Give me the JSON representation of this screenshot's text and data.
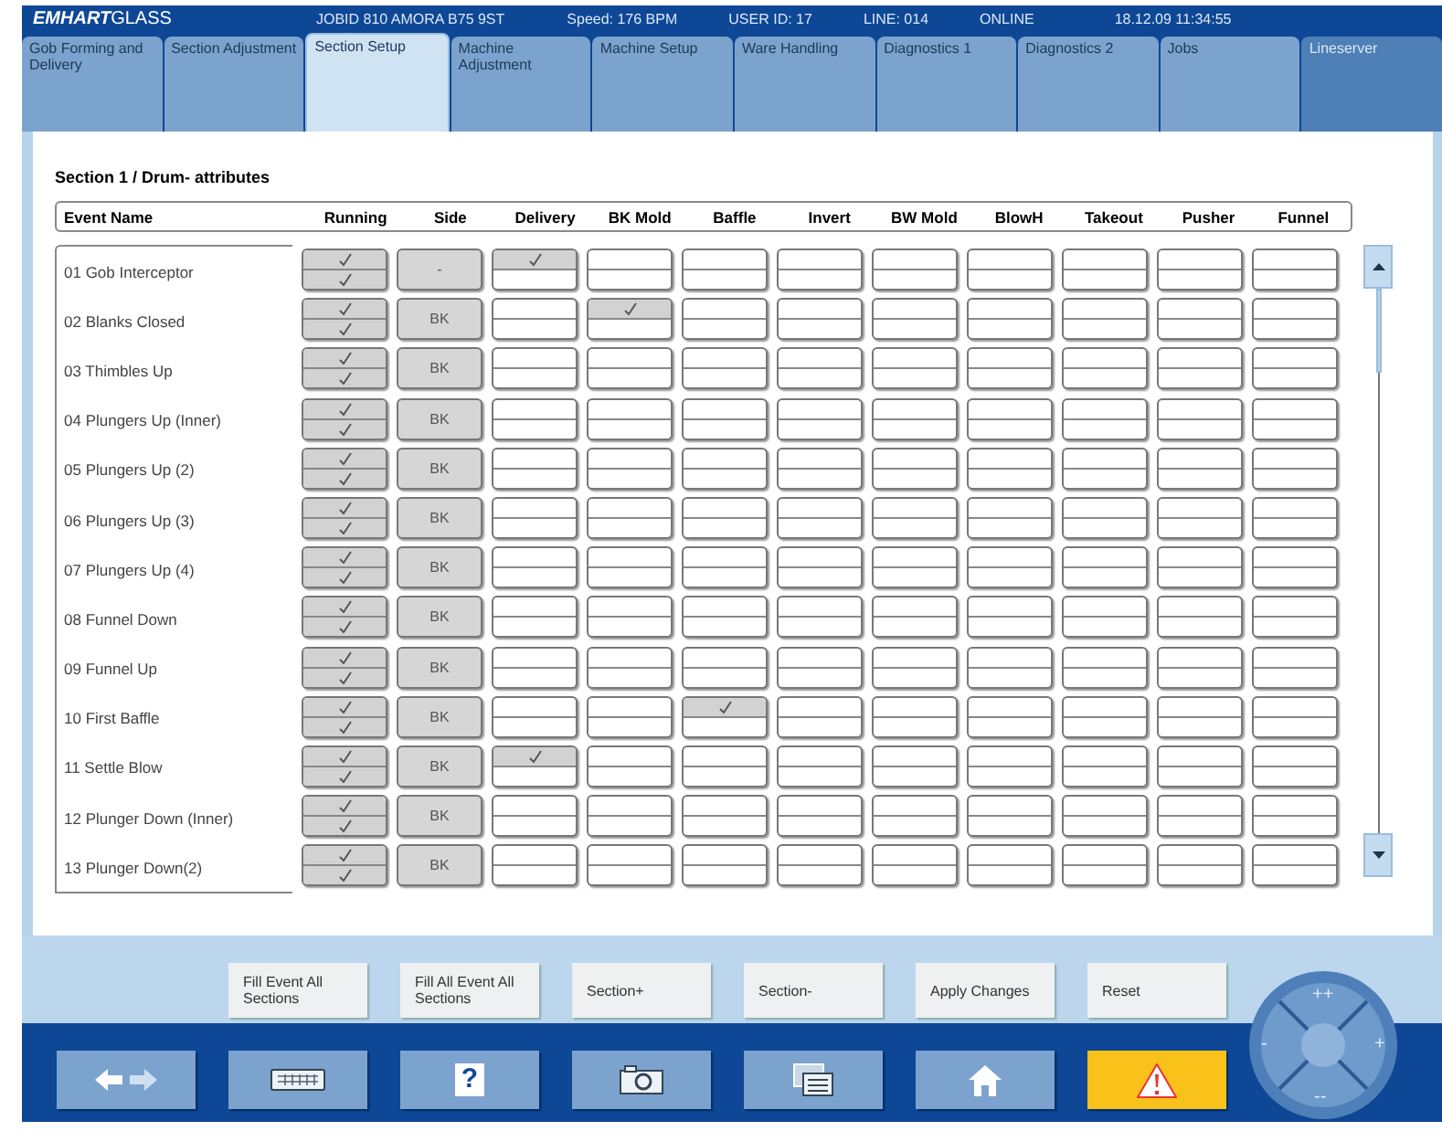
{
  "header": {
    "logo_bold": "EMHART",
    "logo_light": "GLASS",
    "info": [
      "JOBID 810 AMORA B75 9ST",
      "Speed: 176 BPM",
      "USER ID: 17",
      "LINE: 014",
      "ONLINE",
      "18.12.09 11:34:55"
    ]
  },
  "tabs": [
    {
      "label": "Gob Forming and Delivery",
      "selected": false,
      "highlighted": false
    },
    {
      "label": "Section Adjustment",
      "selected": false,
      "highlighted": false
    },
    {
      "label": "Section Setup",
      "selected": true,
      "highlighted": false
    },
    {
      "label": "Machine Adjustment",
      "selected": false,
      "highlighted": false
    },
    {
      "label": "Machine Setup",
      "selected": false,
      "highlighted": false
    },
    {
      "label": "Ware Handling",
      "selected": false,
      "highlighted": false
    },
    {
      "label": "Diagnostics 1",
      "selected": false,
      "highlighted": false
    },
    {
      "label": "Diagnostics 2",
      "selected": false,
      "highlighted": false
    },
    {
      "label": "Jobs",
      "selected": false,
      "highlighted": false
    },
    {
      "label": "Lineserver",
      "selected": false,
      "highlighted": true
    }
  ],
  "section_title": "Section 1 / Drum- attributes",
  "table": {
    "columns": [
      "Event Name",
      "Running",
      "Side",
      "Delivery",
      "BK Mold",
      "Baffle",
      "Invert",
      "BW Mold",
      "BlowH",
      "Takeout",
      "Pusher",
      "Funnel"
    ],
    "rows": [
      {
        "name": "01  Gob Interceptor",
        "side": "-",
        "cells": [
          [
            true,
            true
          ],
          [
            true,
            false
          ],
          [
            false,
            false
          ],
          [
            false,
            false
          ],
          [
            false,
            false
          ],
          [
            false,
            false
          ],
          [
            false,
            false
          ],
          [
            false,
            false
          ],
          [
            false,
            false
          ],
          [
            false,
            false
          ]
        ]
      },
      {
        "name": "02  Blanks Closed",
        "side": "BK",
        "cells": [
          [
            true,
            true
          ],
          [
            false,
            false
          ],
          [
            true,
            false
          ],
          [
            false,
            false
          ],
          [
            false,
            false
          ],
          [
            false,
            false
          ],
          [
            false,
            false
          ],
          [
            false,
            false
          ],
          [
            false,
            false
          ],
          [
            false,
            false
          ]
        ]
      },
      {
        "name": "03  Thimbles Up",
        "side": "BK",
        "cells": [
          [
            true,
            true
          ],
          [
            false,
            false
          ],
          [
            false,
            false
          ],
          [
            false,
            false
          ],
          [
            false,
            false
          ],
          [
            false,
            false
          ],
          [
            false,
            false
          ],
          [
            false,
            false
          ],
          [
            false,
            false
          ],
          [
            false,
            false
          ]
        ]
      },
      {
        "name": "04  Plungers Up (Inner)",
        "side": "BK",
        "cells": [
          [
            true,
            true
          ],
          [
            false,
            false
          ],
          [
            false,
            false
          ],
          [
            false,
            false
          ],
          [
            false,
            false
          ],
          [
            false,
            false
          ],
          [
            false,
            false
          ],
          [
            false,
            false
          ],
          [
            false,
            false
          ],
          [
            false,
            false
          ]
        ]
      },
      {
        "name": "05  Plungers Up (2)",
        "side": "BK",
        "cells": [
          [
            true,
            true
          ],
          [
            false,
            false
          ],
          [
            false,
            false
          ],
          [
            false,
            false
          ],
          [
            false,
            false
          ],
          [
            false,
            false
          ],
          [
            false,
            false
          ],
          [
            false,
            false
          ],
          [
            false,
            false
          ],
          [
            false,
            false
          ]
        ]
      },
      {
        "name": "06  Plungers Up (3)",
        "side": "BK",
        "cells": [
          [
            true,
            true
          ],
          [
            false,
            false
          ],
          [
            false,
            false
          ],
          [
            false,
            false
          ],
          [
            false,
            false
          ],
          [
            false,
            false
          ],
          [
            false,
            false
          ],
          [
            false,
            false
          ],
          [
            false,
            false
          ],
          [
            false,
            false
          ]
        ]
      },
      {
        "name": "07  Plungers Up (4)",
        "side": "BK",
        "cells": [
          [
            true,
            true
          ],
          [
            false,
            false
          ],
          [
            false,
            false
          ],
          [
            false,
            false
          ],
          [
            false,
            false
          ],
          [
            false,
            false
          ],
          [
            false,
            false
          ],
          [
            false,
            false
          ],
          [
            false,
            false
          ],
          [
            false,
            false
          ]
        ]
      },
      {
        "name": "08  Funnel Down",
        "side": "BK",
        "cells": [
          [
            true,
            true
          ],
          [
            false,
            false
          ],
          [
            false,
            false
          ],
          [
            false,
            false
          ],
          [
            false,
            false
          ],
          [
            false,
            false
          ],
          [
            false,
            false
          ],
          [
            false,
            false
          ],
          [
            false,
            false
          ],
          [
            false,
            false
          ]
        ]
      },
      {
        "name": "09  Funnel Up",
        "side": "BK",
        "cells": [
          [
            true,
            true
          ],
          [
            false,
            false
          ],
          [
            false,
            false
          ],
          [
            false,
            false
          ],
          [
            false,
            false
          ],
          [
            false,
            false
          ],
          [
            false,
            false
          ],
          [
            false,
            false
          ],
          [
            false,
            false
          ],
          [
            false,
            false
          ]
        ]
      },
      {
        "name": "10  First Baffle",
        "side": "BK",
        "cells": [
          [
            true,
            true
          ],
          [
            false,
            false
          ],
          [
            false,
            false
          ],
          [
            true,
            false
          ],
          [
            false,
            false
          ],
          [
            false,
            false
          ],
          [
            false,
            false
          ],
          [
            false,
            false
          ],
          [
            false,
            false
          ],
          [
            false,
            false
          ]
        ]
      },
      {
        "name": "11  Settle Blow",
        "side": "BK",
        "cells": [
          [
            true,
            true
          ],
          [
            true,
            false
          ],
          [
            false,
            false
          ],
          [
            false,
            false
          ],
          [
            false,
            false
          ],
          [
            false,
            false
          ],
          [
            false,
            false
          ],
          [
            false,
            false
          ],
          [
            false,
            false
          ],
          [
            false,
            false
          ]
        ]
      },
      {
        "name": "12  Plunger Down (Inner)",
        "side": "BK",
        "cells": [
          [
            true,
            true
          ],
          [
            false,
            false
          ],
          [
            false,
            false
          ],
          [
            false,
            false
          ],
          [
            false,
            false
          ],
          [
            false,
            false
          ],
          [
            false,
            false
          ],
          [
            false,
            false
          ],
          [
            false,
            false
          ],
          [
            false,
            false
          ]
        ]
      },
      {
        "name": "13  Plunger Down(2)",
        "side": "BK",
        "cells": [
          [
            true,
            true
          ],
          [
            false,
            false
          ],
          [
            false,
            false
          ],
          [
            false,
            false
          ],
          [
            false,
            false
          ],
          [
            false,
            false
          ],
          [
            false,
            false
          ],
          [
            false,
            false
          ],
          [
            false,
            false
          ],
          [
            false,
            false
          ]
        ]
      }
    ]
  },
  "actions": [
    "Fill Event All Sections",
    "Fill All Event All Sections",
    "Section+",
    "Section-",
    "Apply Changes",
    "Reset"
  ],
  "nav": [
    {
      "kind": "arrows"
    },
    {
      "kind": "keyboard"
    },
    {
      "kind": "help",
      "label": "?"
    },
    {
      "kind": "camera"
    },
    {
      "kind": "windows"
    },
    {
      "kind": "home"
    },
    {
      "kind": "warning"
    }
  ],
  "jog": {
    "up": "++",
    "right": "+",
    "down": "--",
    "left": "-"
  }
}
